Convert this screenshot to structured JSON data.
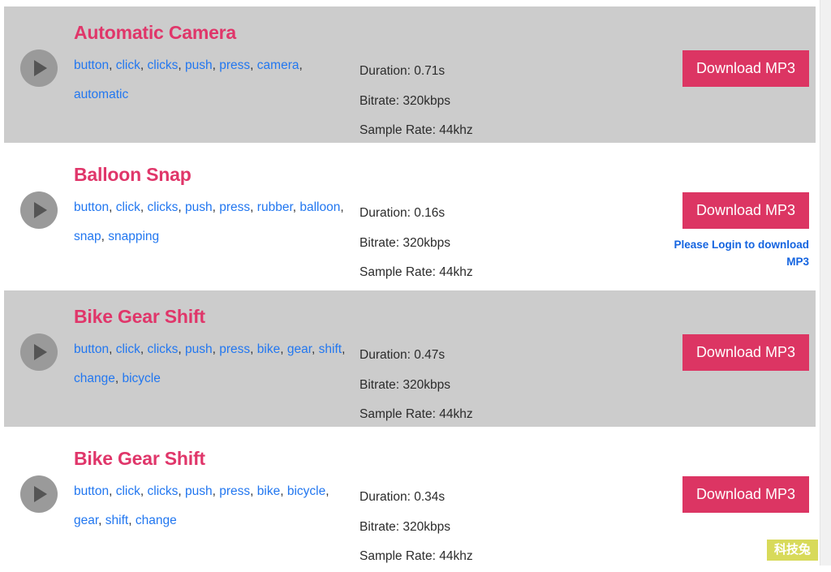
{
  "page": {
    "watermark": "科技兔",
    "colors": {
      "title": "#e0366a",
      "button": "#dc3563",
      "tag_link": "#2277f0",
      "login_note": "#1464e0",
      "row_alt_bg": "#cccccc",
      "row_bg": "#ffffff",
      "play_circle": "#9a9a9a",
      "play_triangle": "#555555",
      "watermark_bg": "#d8da5a"
    }
  },
  "labels": {
    "play_icon": "play-icon",
    "download": "Download MP3",
    "duration_prefix": "Duration: ",
    "bitrate_prefix": "Bitrate: ",
    "sample_rate_prefix": "Sample Rate: "
  },
  "results": [
    {
      "title": "Automatic Camera",
      "tags": [
        "button",
        "click",
        "clicks",
        "push",
        "press",
        "camera",
        "automatic"
      ],
      "duration": "Duration: 0.71s",
      "bitrate": "Bitrate: 320kbps",
      "sample_rate": "Sample Rate: 44khz",
      "download_label": "Download MP3",
      "login_note": "",
      "shaded": true
    },
    {
      "title": "Balloon Snap",
      "tags": [
        "button",
        "click",
        "clicks",
        "push",
        "press",
        "rubber",
        "balloon",
        "snap",
        "snapping"
      ],
      "duration": "Duration: 0.16s",
      "bitrate": "Bitrate: 320kbps",
      "sample_rate": "Sample Rate: 44khz",
      "download_label": "Download MP3",
      "login_note": "Please Login to download MP3",
      "shaded": false
    },
    {
      "title": "Bike Gear Shift",
      "tags": [
        "button",
        "click",
        "clicks",
        "push",
        "press",
        "bike",
        "gear",
        "shift",
        "change",
        "bicycle"
      ],
      "duration": "Duration: 0.47s",
      "bitrate": "Bitrate: 320kbps",
      "sample_rate": "Sample Rate: 44khz",
      "download_label": "Download MP3",
      "login_note": "",
      "shaded": true
    },
    {
      "title": "Bike Gear Shift",
      "tags": [
        "button",
        "click",
        "clicks",
        "push",
        "press",
        "bike",
        "bicycle",
        "gear",
        "shift",
        "change"
      ],
      "duration": "Duration: 0.34s",
      "bitrate": "Bitrate: 320kbps",
      "sample_rate": "Sample Rate: 44khz",
      "download_label": "Download MP3",
      "login_note": "",
      "shaded": false
    }
  ]
}
